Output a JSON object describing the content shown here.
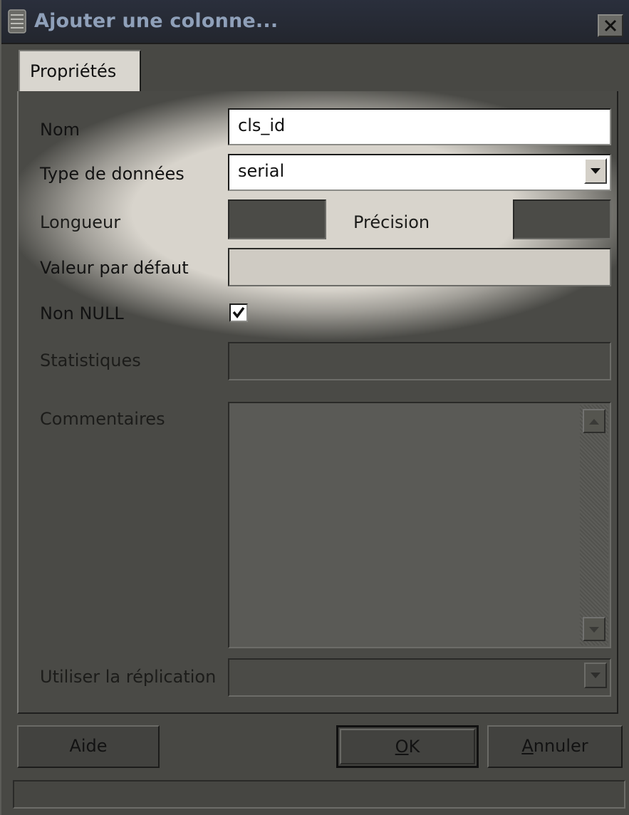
{
  "window": {
    "title": "Ajouter une colonne...",
    "close_glyph": "X"
  },
  "tabs": [
    {
      "label": "Propriétés",
      "active": true
    }
  ],
  "form": {
    "name": {
      "label": "Nom",
      "value": "cls_id"
    },
    "datatype": {
      "label": "Type de données",
      "value": "serial"
    },
    "length": {
      "label": "Longueur",
      "value": ""
    },
    "precision": {
      "label": "Précision",
      "value": ""
    },
    "default": {
      "label": "Valeur par défaut",
      "value": ""
    },
    "not_null": {
      "label": "Non NULL",
      "checked": true
    },
    "statistics": {
      "label": "Statistiques",
      "value": ""
    },
    "comments": {
      "label": "Commentaires",
      "value": ""
    },
    "replication": {
      "label": "Utiliser la réplication",
      "value": ""
    }
  },
  "buttons": {
    "help": "Aide",
    "ok_underlined": "O",
    "ok_rest": "K",
    "cancel_underlined": "A",
    "cancel_rest": "nnuler"
  },
  "icons": {
    "title": "database-column-icon",
    "close": "close-icon",
    "dropdown": "chevron-down-icon",
    "check": "checkmark-icon",
    "scroll_up": "arrow-up-icon",
    "scroll_down": "arrow-down-icon"
  },
  "colors": {
    "titlebar": "#252a35",
    "title_text": "#8fa0b9",
    "highlight_glow": "#d8d4cc",
    "dimmed_panel": "#4a4a46"
  }
}
